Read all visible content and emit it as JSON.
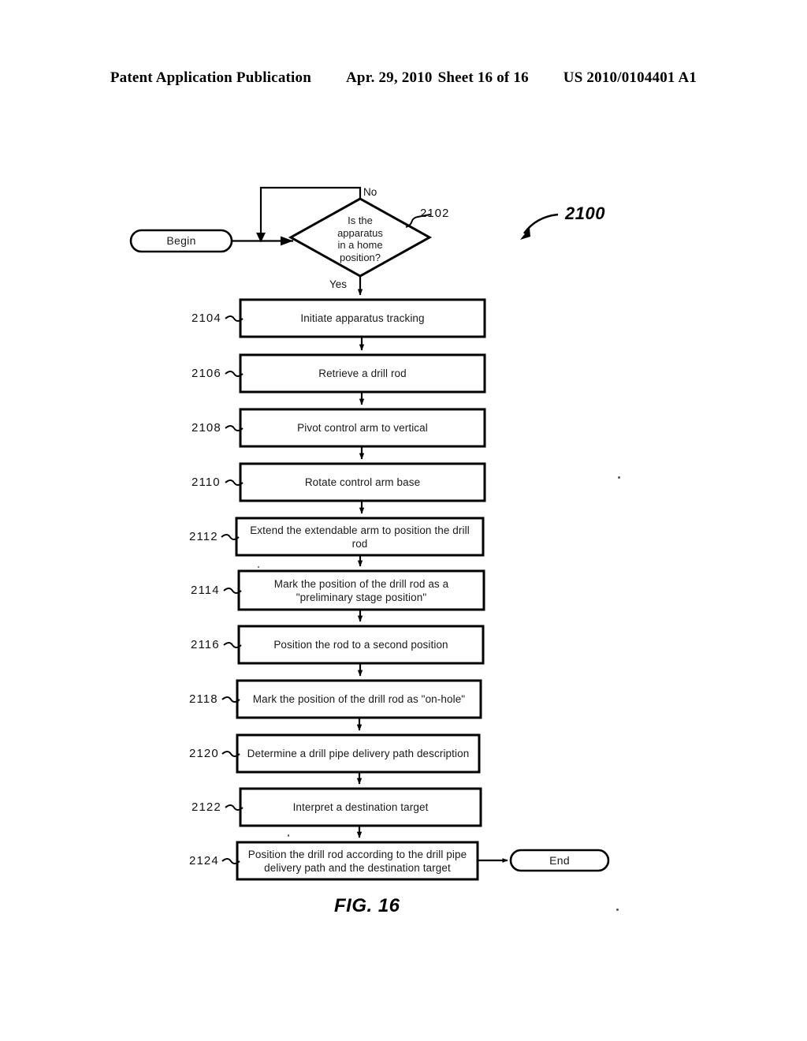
{
  "header": {
    "publication": "Patent Application Publication",
    "date": "Apr. 29, 2010",
    "sheet": "Sheet 16 of 16",
    "patent_number": "US 2010/0104401 A1"
  },
  "figure": {
    "caption": "FIG. 16",
    "diagram_ref": "2100",
    "ink_color": "#000000",
    "background_color": "#ffffff"
  },
  "flowchart": {
    "start_terminal": {
      "label": "Begin",
      "shape": "rounded-terminal"
    },
    "decision": {
      "ref": "2102",
      "line1": "Is the",
      "line2": "apparatus",
      "line3": "in a home",
      "line4": "position?",
      "yes_label": "Yes",
      "no_label": "No",
      "shape": "diamond"
    },
    "steps": [
      {
        "ref": "2104",
        "text": "Initiate apparatus tracking",
        "lines": 1
      },
      {
        "ref": "2106",
        "text": "Retrieve a drill rod",
        "lines": 1
      },
      {
        "ref": "2108",
        "text": "Pivot control arm to vertical",
        "lines": 1
      },
      {
        "ref": "2110",
        "text": "Rotate control arm base",
        "lines": 1
      },
      {
        "ref": "2112",
        "line1": "Extend the extendable arm to position the drill",
        "line2": "rod",
        "lines": 2
      },
      {
        "ref": "2114",
        "line1": "Mark the position of the drill rod as a",
        "line2": "\"preliminary stage position\"",
        "lines": 2
      },
      {
        "ref": "2116",
        "text": "Position the rod to a second position",
        "lines": 1
      },
      {
        "ref": "2118",
        "text": "Mark the position of the drill rod as \"on-hole\"",
        "lines": 1
      },
      {
        "ref": "2120",
        "text": "Determine a drill pipe delivery path description",
        "lines": 1
      },
      {
        "ref": "2122",
        "text": "Interpret a destination target",
        "lines": 1
      },
      {
        "ref": "2124",
        "line1": "Position the drill rod according to the drill pipe",
        "line2": "delivery path and the destination target",
        "lines": 2
      }
    ],
    "end_terminal": {
      "label": "End",
      "shape": "rounded-terminal"
    }
  }
}
